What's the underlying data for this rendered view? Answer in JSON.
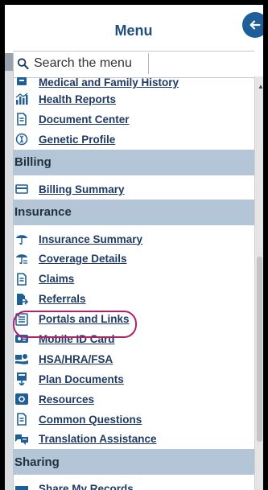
{
  "header": {
    "title": "Menu"
  },
  "search": {
    "placeholder": "Search the menu"
  },
  "items_top": [
    {
      "label": "Medical and Family History",
      "icon": "clipboard-icon"
    },
    {
      "label": "Health Reports",
      "icon": "bar-chart-icon"
    },
    {
      "label": "Document Center",
      "icon": "document-icon"
    },
    {
      "label": "Genetic Profile",
      "icon": "dna-icon"
    }
  ],
  "sections": {
    "billing": "Billing",
    "insurance": "Insurance",
    "sharing": "Sharing"
  },
  "billing_items": [
    {
      "label": "Billing Summary",
      "icon": "credit-card-icon"
    }
  ],
  "insurance_items": [
    {
      "label": "Insurance Summary",
      "icon": "umbrella-icon"
    },
    {
      "label": "Coverage Details",
      "icon": "umbrella-detail-icon"
    },
    {
      "label": "Claims",
      "icon": "document-icon"
    },
    {
      "label": "Referrals",
      "icon": "referral-icon"
    },
    {
      "label": "Portals and Links",
      "icon": "portal-icon"
    },
    {
      "label": "Mobile ID Card",
      "icon": "id-card-icon"
    },
    {
      "label": "HSA/HRA/FSA",
      "icon": "money-hand-icon"
    },
    {
      "label": "Plan Documents",
      "icon": "plan-document-icon"
    },
    {
      "label": "Resources",
      "icon": "resources-icon"
    },
    {
      "label": "Common Questions",
      "icon": "document-icon"
    },
    {
      "label": "Translation Assistance",
      "icon": "translation-icon"
    }
  ],
  "sharing_items": [
    {
      "label": "Share My Records",
      "icon": "share-icon"
    }
  ],
  "colors": {
    "accent": "#1f5f99",
    "section_bg": "#b3c5d6",
    "highlight": "#b0226b"
  }
}
